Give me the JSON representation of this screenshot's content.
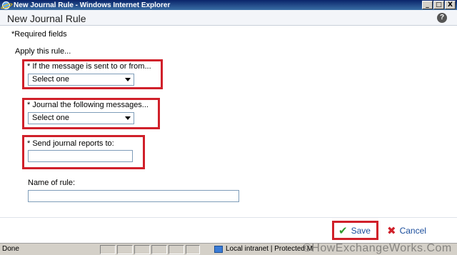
{
  "window": {
    "title": "New Journal Rule - Windows Internet Explorer",
    "buttons": {
      "minimize": "_",
      "maximize": "□",
      "close": "X"
    }
  },
  "header": {
    "title": "New Journal Rule",
    "help": "?"
  },
  "form": {
    "required_note": "*Required fields",
    "apply_label": "Apply this rule...",
    "sent_to_from": {
      "label": "* If the message is sent to or from...",
      "value": "Select one"
    },
    "journal_messages": {
      "label": "* Journal the following messages...",
      "value": "Select one"
    },
    "send_reports": {
      "label": "* Send journal reports to:",
      "value": ""
    },
    "rule_name": {
      "label": "Name of rule:",
      "value": ""
    }
  },
  "actions": {
    "save": "Save",
    "cancel": "Cancel"
  },
  "status": {
    "text": "Done",
    "zone": "Local intranet | Protected M"
  },
  "watermark": "©HowExchangeWorks.Com",
  "colors": {
    "highlight": "#d0202a",
    "link": "#1a4d9c",
    "save_icon": "#2e9b2e"
  }
}
